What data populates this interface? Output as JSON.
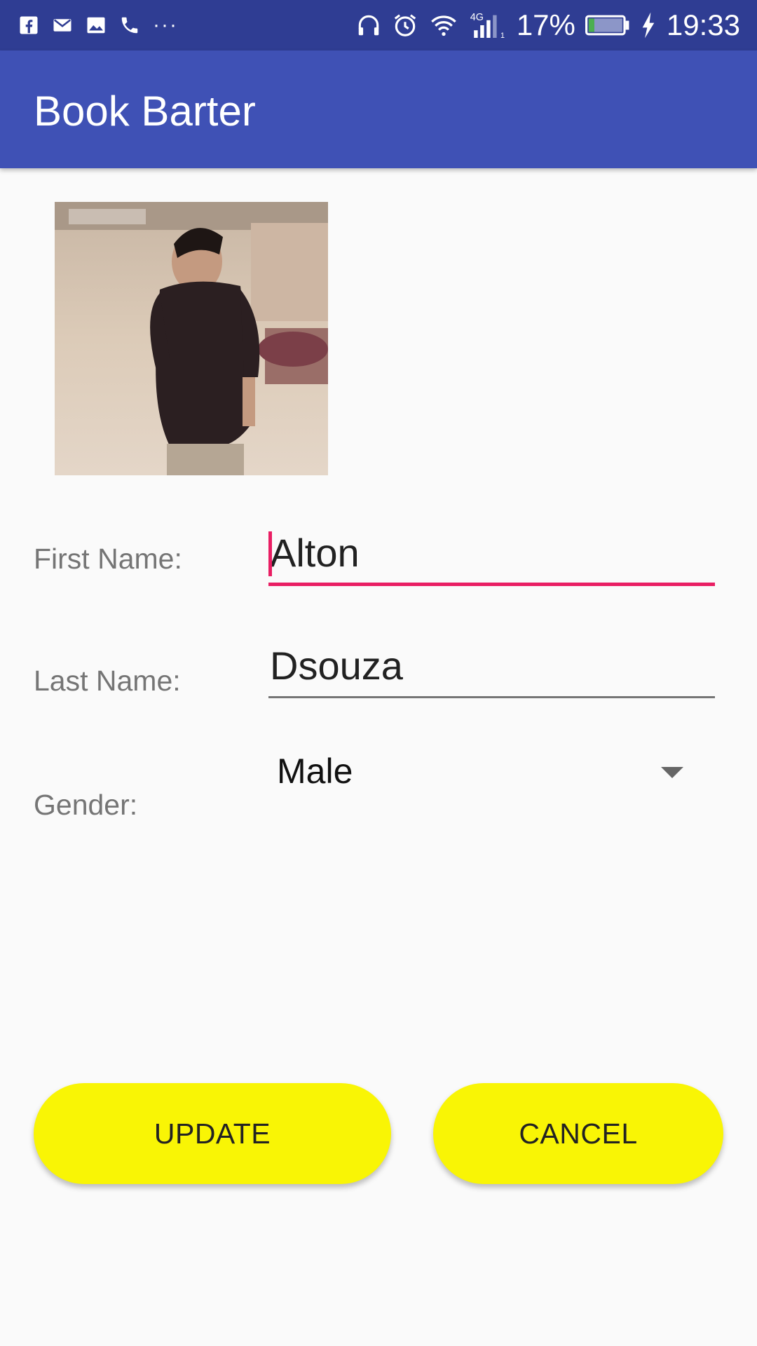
{
  "status_bar": {
    "left_icons": [
      "facebook-icon",
      "gmail-icon",
      "image-icon",
      "phone-icon"
    ],
    "overflow_dots": "···",
    "right_icons": [
      "headphones-icon",
      "alarm-icon",
      "wifi-icon",
      "signal-4g-icon"
    ],
    "network_label": "4G",
    "battery_percent": "17%",
    "battery_level": 0.17,
    "time": "19:33"
  },
  "app_bar": {
    "title": "Book Barter"
  },
  "profile": {
    "photo_icon": "profile-photo"
  },
  "form": {
    "first_name": {
      "label": "First Name:",
      "value": "Alton"
    },
    "last_name": {
      "label": "Last Name:",
      "value": "Dsouza"
    },
    "gender": {
      "label": "Gender:",
      "selected": "Male"
    }
  },
  "buttons": {
    "update_label": "UPDATE",
    "cancel_label": "CANCEL"
  },
  "colors": {
    "status_bar": "#2f3d93",
    "app_bar": "#3f51b5",
    "accent": "#e91e63",
    "button": "#f9f505",
    "battery_fill": "#4caf50"
  }
}
